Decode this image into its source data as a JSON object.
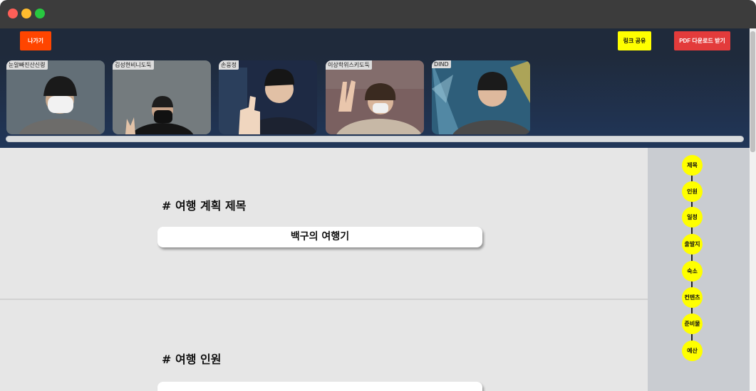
{
  "toolbar": {
    "exit_label": "나가기",
    "share_label": "링크 공유",
    "pdf_label": "PDF 다운로드 받기"
  },
  "participants": [
    {
      "name": "눈알빠진산신령",
      "bg": "#5a6670",
      "shirt": "#6d6c6a"
    },
    {
      "name": "김성현비니도둑",
      "bg": "#747b7e",
      "shirt": "#151515"
    },
    {
      "name": "손웅정",
      "bg": "#1e2a44",
      "shirt": "#1c2230"
    },
    {
      "name": "이상학위스키도둑",
      "bg": "#7a6060",
      "shirt": "#c7b8a6"
    },
    {
      "name": "DIND",
      "bg": "#2e5e7a",
      "shirt": "#4a4a4a"
    }
  ],
  "sections": [
    {
      "title": "# 여행 계획 제목",
      "value": "백구의 여행기"
    },
    {
      "title": "# 여행 인원",
      "value": ""
    }
  ],
  "steps": [
    "제목",
    "인원",
    "일정",
    "출발지",
    "숙소",
    "컨텐츠",
    "준비물",
    "예산"
  ],
  "colors": {
    "exit": "#ff4500",
    "share": "#ffff00",
    "pdf": "#e33b3b",
    "step": "#ffff00"
  }
}
